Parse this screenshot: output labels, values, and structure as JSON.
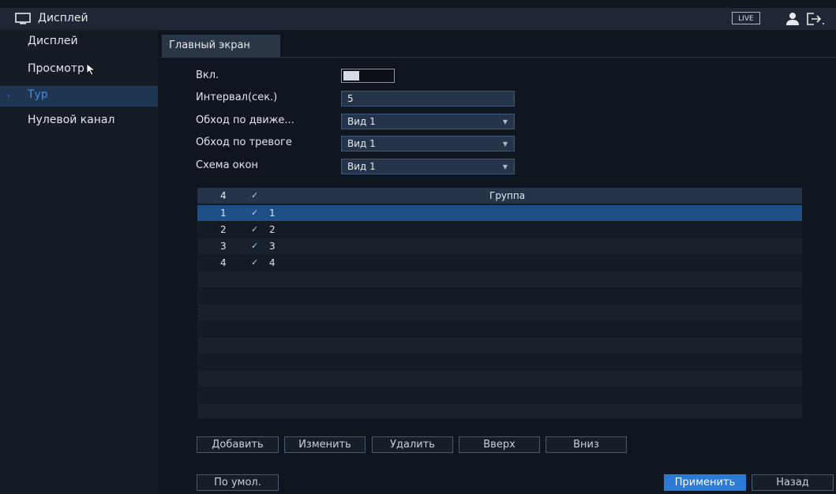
{
  "header": {
    "title": "Дисплей",
    "live_badge": "LIVE",
    "icons": {
      "monitor": "monitor-icon",
      "user": "user-icon",
      "logout": "logout-icon"
    }
  },
  "sidebar": {
    "items": [
      {
        "label": "Дисплей",
        "active": false
      },
      {
        "label": "Просмотр",
        "active": false
      },
      {
        "label": "Тур",
        "active": true
      },
      {
        "label": "Нулевой канал",
        "active": false
      }
    ]
  },
  "tab": {
    "label": "Главный экран"
  },
  "form": {
    "enable_label": "Вкл.",
    "enable_on": false,
    "interval_label": "Интервал(сек.)",
    "interval_value": "5",
    "motion_label": "Обход по движе...",
    "motion_value": "Вид 1",
    "alarm_label": "Обход по тревоге",
    "alarm_value": "Вид 1",
    "window_label": "Схема окон",
    "window_value": "Вид 1"
  },
  "table": {
    "header": {
      "count": "4",
      "check": "✓",
      "group": "Группа"
    },
    "rows": [
      {
        "index": "1",
        "check": "✓",
        "group": "1",
        "selected": true
      },
      {
        "index": "2",
        "check": "✓",
        "group": "2",
        "selected": false
      },
      {
        "index": "3",
        "check": "✓",
        "group": "3",
        "selected": false
      },
      {
        "index": "4",
        "check": "✓",
        "group": "4",
        "selected": false
      }
    ]
  },
  "buttons": {
    "add": "Добавить",
    "edit": "Изменить",
    "delete": "Удалить",
    "up": "Вверх",
    "down": "Вниз",
    "default": "По умол.",
    "apply": "Применить",
    "back": "Назад"
  },
  "colors": {
    "accent": "#2b7bd6",
    "selected_row": "#1e4f86",
    "active_text": "#3d8fe0"
  }
}
